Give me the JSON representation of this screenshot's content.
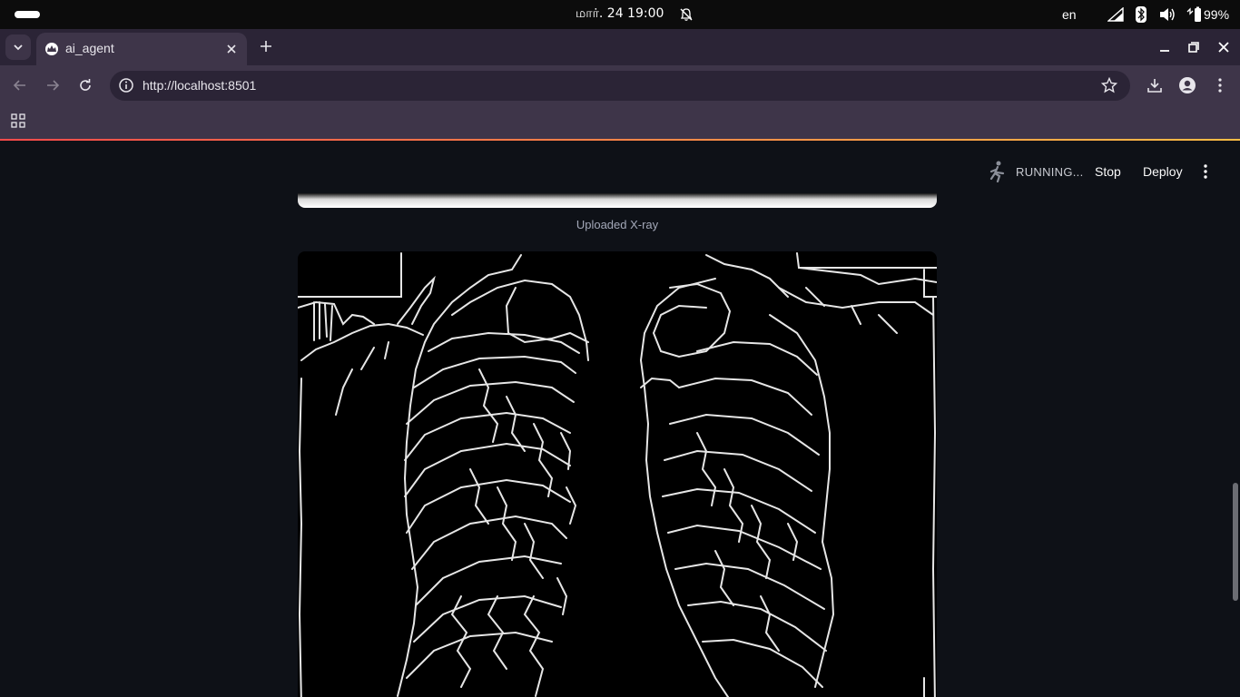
{
  "os": {
    "clock": "மார். 24  19:00",
    "lang": "en",
    "battery": "99%"
  },
  "browser": {
    "tab_title": "ai_agent",
    "url": "http://localhost:8501"
  },
  "app": {
    "status": "RUNNING...",
    "stop_label": "Stop",
    "deploy_label": "Deploy",
    "caption": "Uploaded X-ray"
  },
  "icons": {
    "tab_list": "chevron-down-icon",
    "favicon": "streamlit-crown-icon",
    "close": "close-icon",
    "new_tab": "plus-icon",
    "back": "arrow-left-icon",
    "forward": "arrow-right-icon",
    "reload": "reload-icon",
    "info": "info-icon",
    "bookmark": "star-icon",
    "download": "download-icon",
    "profile": "account-icon",
    "menu": "kebab-icon",
    "apps": "apps-grid-icon",
    "running": "running-man-icon"
  },
  "colors": {
    "app_bg": "#0e1117",
    "accent_red": "#ff4b4b",
    "accent_yellow": "#ffbd45",
    "browser_frame": "#3e3549"
  }
}
